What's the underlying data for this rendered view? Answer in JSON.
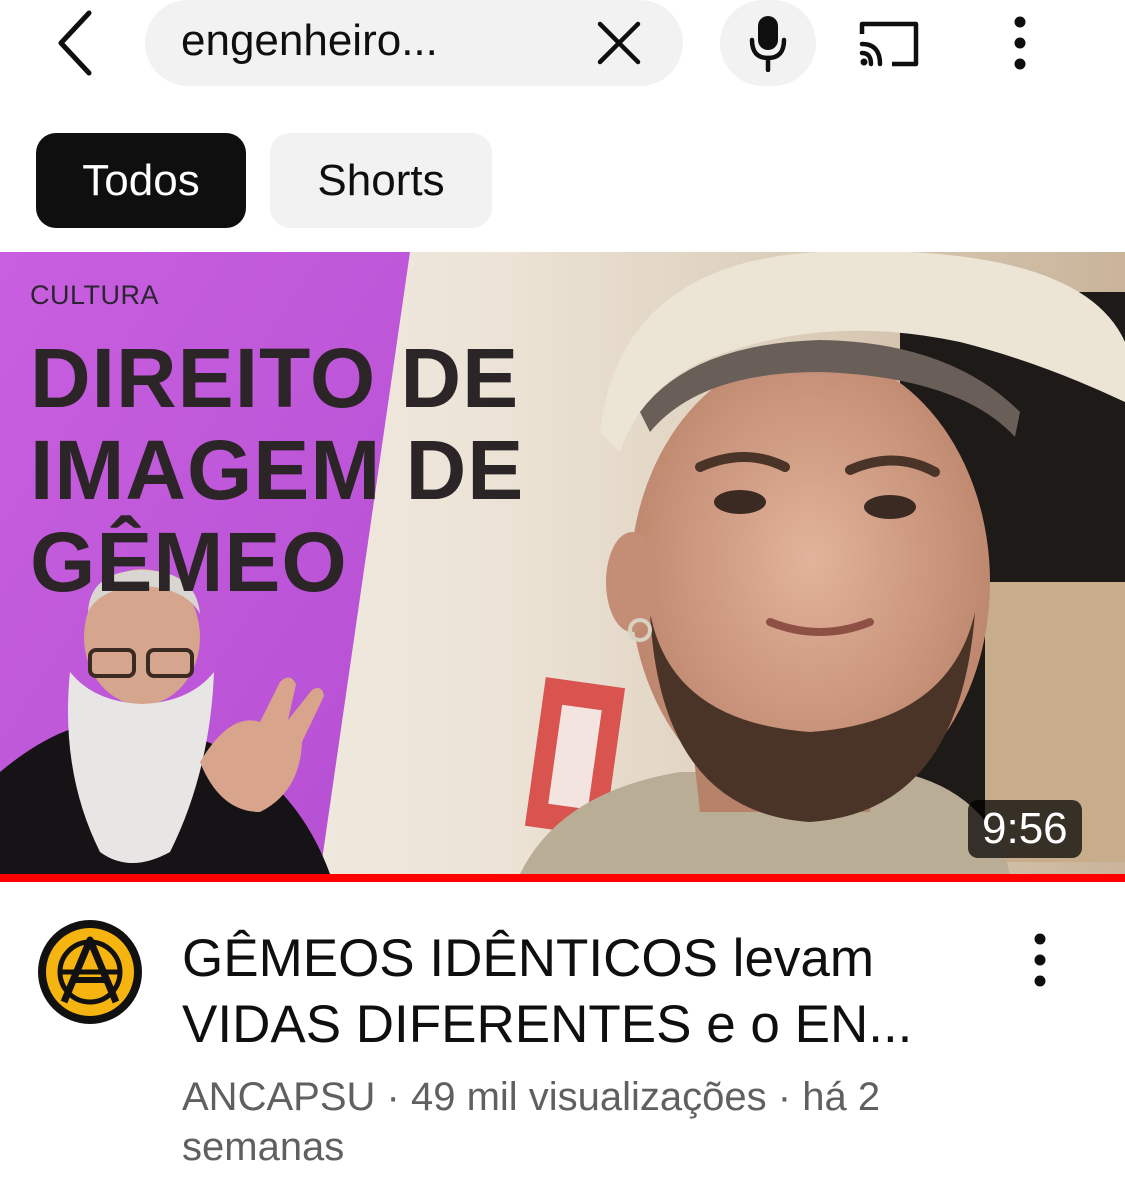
{
  "topbar": {
    "back_icon": "chevron-left-icon",
    "search_query": "engenheiro...",
    "clear_icon": "close-icon",
    "mic_icon": "microphone-icon",
    "cast_icon": "cast-icon",
    "more_icon": "more-vertical-icon"
  },
  "chips": [
    {
      "label": "Todos",
      "active": true
    },
    {
      "label": "Shorts",
      "active": false
    }
  ],
  "video": {
    "thumbnail": {
      "kicker": "CULTURA",
      "headline": [
        "DIREITO DE",
        "IMAGEM DE",
        "GÊMEO"
      ],
      "accent_color": "#cc5ee0"
    },
    "duration": "9:56",
    "watch_progress": 1.0,
    "progress_color": "#ff0000",
    "title_lines": [
      "GÊMEOS IDÊNTICOS levam",
      "VIDAS DIFERENTES e o EN..."
    ],
    "channel": "ANCAPSU",
    "views": "49 mil visualizações",
    "age_lines": [
      "há 2",
      "semanas"
    ],
    "separator": "·",
    "avatar_color": "#f5b40f",
    "menu_icon": "more-vertical-icon"
  }
}
